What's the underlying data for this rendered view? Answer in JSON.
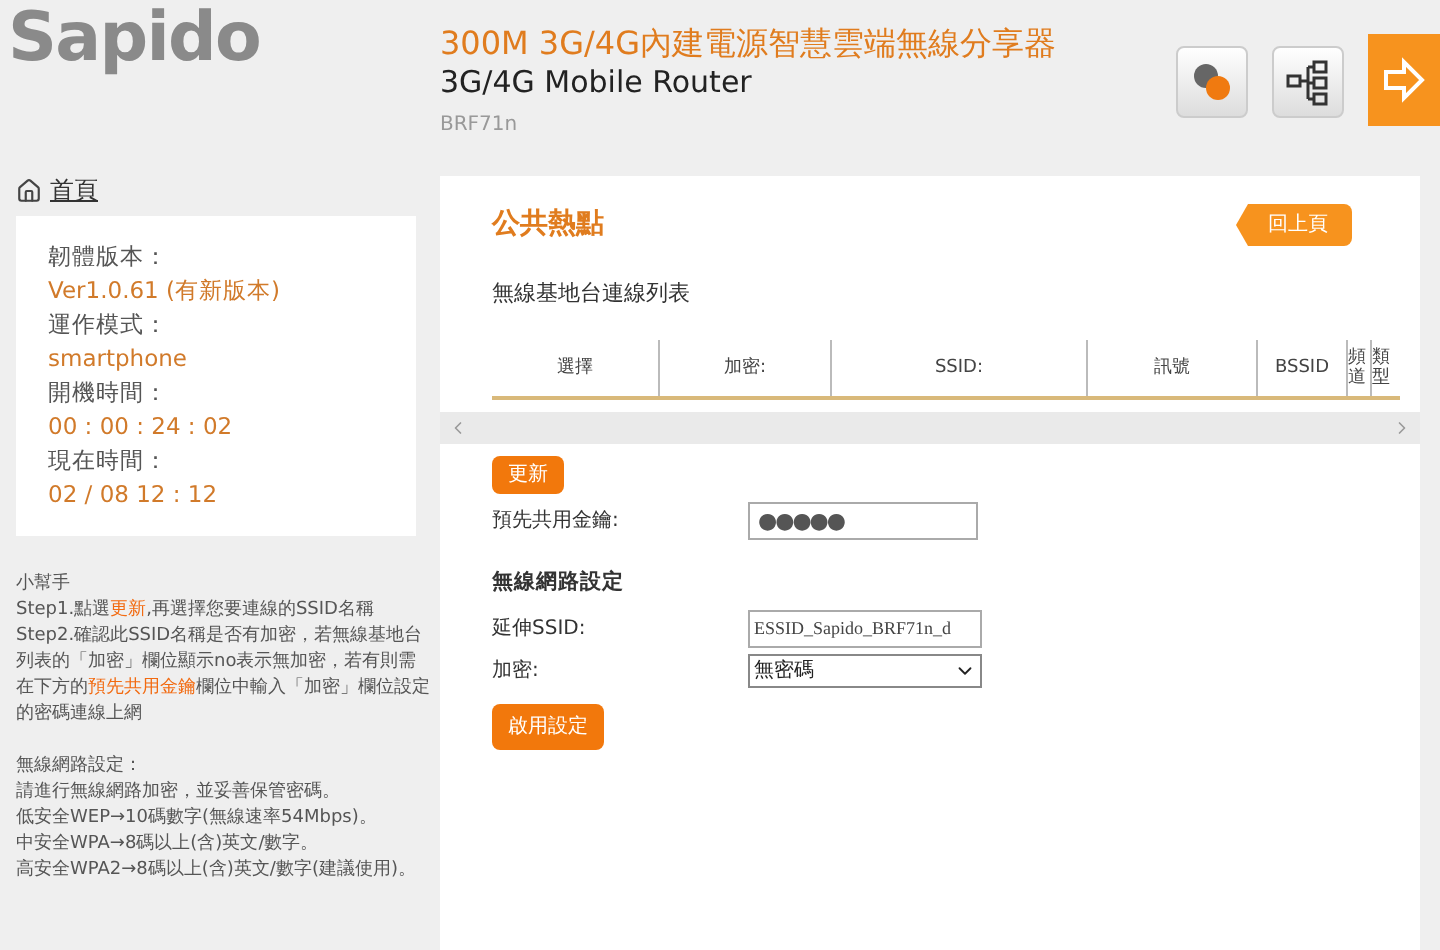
{
  "header": {
    "logo": "Sapido",
    "title": "300M 3G/4G內建電源智慧雲端無線分享器",
    "subtitle": "3G/4G Mobile Router",
    "model": "BRF71n"
  },
  "sidebar": {
    "home": "首頁",
    "info": [
      {
        "label": "韌體版本：",
        "value": "Ver1.0.61 (有新版本)"
      },
      {
        "label": "運作模式：",
        "value": "smartphone"
      },
      {
        "label": "開機時間：",
        "value": "00 : 00 : 24 : 02"
      },
      {
        "label": "現在時間：",
        "value": "02 / 08  12 : 12"
      }
    ],
    "help": [
      [
        {
          "text": "小幫手",
          "highlight": false
        }
      ],
      [
        {
          "text": "Step1.點選",
          "highlight": false
        },
        {
          "text": "更新",
          "highlight": true
        },
        {
          "text": ",再選擇您要連線的SSID名稱",
          "highlight": false
        }
      ],
      [
        {
          "text": "Step2.確認此SSID名稱是否有加密，若無線基地台列表的「加密」欄位顯示no表示無加密，若有則需在下方的",
          "highlight": false
        },
        {
          "text": "預先共用金鑰",
          "highlight": true
        },
        {
          "text": "欄位中輸入「加密」欄位設定的密碼連線上網",
          "highlight": false
        }
      ],
      [
        {
          "text": "無線網路設定：",
          "highlight": false
        }
      ],
      [
        {
          "text": "請進行無線網路加密，並妥善保管密碼。",
          "highlight": false
        }
      ],
      [
        {
          "text": "低安全WEP→10碼數字(無線速率54Mbps)。",
          "highlight": false
        }
      ],
      [
        {
          "text": "中安全WPA→8碼以上(含)英文/數字。",
          "highlight": false
        }
      ],
      [
        {
          "text": "高安全WPA2→8碼以上(含)英文/數字(建議使用)。",
          "highlight": false
        }
      ]
    ]
  },
  "main": {
    "title": "公共熱點",
    "back_button": "回上頁",
    "list_title": "無線基地台連線列表",
    "table": {
      "columns": [
        "選擇",
        "加密:",
        "SSID:",
        "訊號",
        "BSSID",
        "頻道",
        "類型"
      ]
    },
    "refresh_button": "更新",
    "psk": {
      "label": "預先共用金鑰:",
      "value": "●●●●●"
    },
    "wireless_title": "無線網路設定",
    "ssid": {
      "label": "延伸SSID:",
      "value": "ESSID_Sapido_BRF71n_d"
    },
    "encryption": {
      "label": "加密:",
      "value": "無密碼"
    },
    "apply_button": "啟用設定"
  }
}
